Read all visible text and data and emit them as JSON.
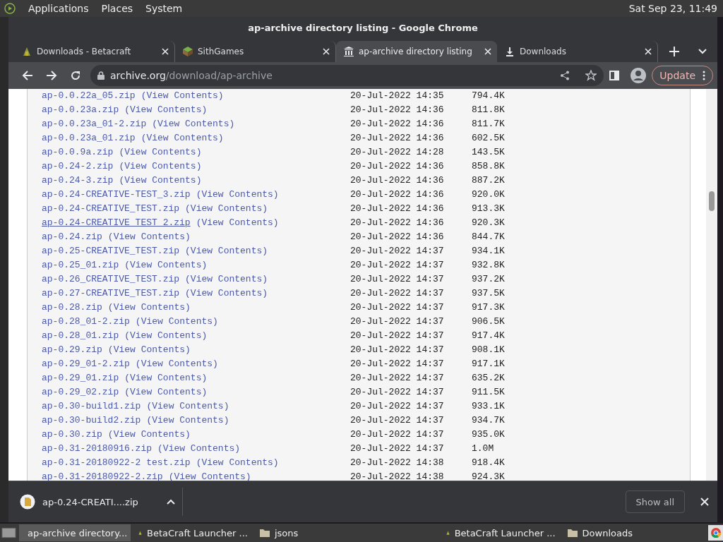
{
  "top_panel": {
    "menus": [
      "Applications",
      "Places",
      "System"
    ],
    "clock": "Sat Sep 23, 11:49"
  },
  "window": {
    "title": "ap-archive directory listing - Google Chrome"
  },
  "tabs": [
    {
      "label": "Downloads - Betacraft",
      "kind": "logo",
      "selected": false
    },
    {
      "label": "SithGames",
      "kind": "block",
      "selected": false
    },
    {
      "label": "ap-archive directory listing",
      "kind": "archive",
      "selected": true
    },
    {
      "label": "Downloads",
      "kind": "download",
      "selected": false
    }
  ],
  "toolbar": {
    "url_host": "archive.org",
    "url_path": "/download/ap-archive",
    "update_label": "Update"
  },
  "listing": {
    "rows": [
      {
        "name": "ap-0.0.22a_05.zip",
        "link": "(View Contents)",
        "date": "20-Jul-2022 14:35",
        "size": "794.4K",
        "hovered": false
      },
      {
        "name": "ap-0.0.23a.zip",
        "link": "(View Contents)",
        "date": "20-Jul-2022 14:36",
        "size": "811.8K",
        "hovered": false
      },
      {
        "name": "ap-0.0.23a_01-2.zip",
        "link": "(View Contents)",
        "date": "20-Jul-2022 14:36",
        "size": "811.7K",
        "hovered": false
      },
      {
        "name": "ap-0.0.23a_01.zip",
        "link": "(View Contents)",
        "date": "20-Jul-2022 14:36",
        "size": "602.5K",
        "hovered": false
      },
      {
        "name": "ap-0.0.9a.zip",
        "link": "(View Contents)",
        "date": "20-Jul-2022 14:28",
        "size": "143.5K",
        "hovered": false
      },
      {
        "name": "ap-0.24-2.zip",
        "link": "(View Contents)",
        "date": "20-Jul-2022 14:36",
        "size": "858.8K",
        "hovered": false
      },
      {
        "name": "ap-0.24-3.zip",
        "link": "(View Contents)",
        "date": "20-Jul-2022 14:36",
        "size": "887.2K",
        "hovered": false
      },
      {
        "name": "ap-0.24-CREATIVE-TEST_3.zip",
        "link": "(View Contents)",
        "date": "20-Jul-2022 14:36",
        "size": "920.0K",
        "hovered": false
      },
      {
        "name": "ap-0.24-CREATIVE_TEST.zip",
        "link": "(View Contents)",
        "date": "20-Jul-2022 14:36",
        "size": "913.3K",
        "hovered": false
      },
      {
        "name": "ap-0.24-CREATIVE_TEST_2.zip",
        "link": "(View Contents)",
        "date": "20-Jul-2022 14:36",
        "size": "920.3K",
        "hovered": true
      },
      {
        "name": "ap-0.24.zip",
        "link": "(View Contents)",
        "date": "20-Jul-2022 14:36",
        "size": "844.7K",
        "hovered": false
      },
      {
        "name": "ap-0.25-CREATIVE_TEST.zip",
        "link": "(View Contents)",
        "date": "20-Jul-2022 14:37",
        "size": "934.1K",
        "hovered": false
      },
      {
        "name": "ap-0.25_01.zip",
        "link": "(View Contents)",
        "date": "20-Jul-2022 14:37",
        "size": "932.8K",
        "hovered": false
      },
      {
        "name": "ap-0.26_CREATIVE_TEST.zip",
        "link": "(View Contents)",
        "date": "20-Jul-2022 14:37",
        "size": "937.2K",
        "hovered": false
      },
      {
        "name": "ap-0.27-CREATIVE_TEST.zip",
        "link": "(View Contents)",
        "date": "20-Jul-2022 14:37",
        "size": "937.5K",
        "hovered": false
      },
      {
        "name": "ap-0.28.zip",
        "link": "(View Contents)",
        "date": "20-Jul-2022 14:37",
        "size": "917.3K",
        "hovered": false
      },
      {
        "name": "ap-0.28_01-2.zip",
        "link": "(View Contents)",
        "date": "20-Jul-2022 14:37",
        "size": "906.5K",
        "hovered": false
      },
      {
        "name": "ap-0.28_01.zip",
        "link": "(View Contents)",
        "date": "20-Jul-2022 14:37",
        "size": "917.4K",
        "hovered": false
      },
      {
        "name": "ap-0.29.zip",
        "link": "(View Contents)",
        "date": "20-Jul-2022 14:37",
        "size": "908.1K",
        "hovered": false
      },
      {
        "name": "ap-0.29_01-2.zip",
        "link": "(View Contents)",
        "date": "20-Jul-2022 14:37",
        "size": "917.1K",
        "hovered": false
      },
      {
        "name": "ap-0.29_01.zip",
        "link": "(View Contents)",
        "date": "20-Jul-2022 14:37",
        "size": "635.2K",
        "hovered": false
      },
      {
        "name": "ap-0.29_02.zip",
        "link": "(View Contents)",
        "date": "20-Jul-2022 14:37",
        "size": "911.5K",
        "hovered": false
      },
      {
        "name": "ap-0.30-build1.zip",
        "link": "(View Contents)",
        "date": "20-Jul-2022 14:37",
        "size": "933.1K",
        "hovered": false
      },
      {
        "name": "ap-0.30-build2.zip",
        "link": "(View Contents)",
        "date": "20-Jul-2022 14:37",
        "size": "934.7K",
        "hovered": false
      },
      {
        "name": "ap-0.30.zip",
        "link": "(View Contents)",
        "date": "20-Jul-2022 14:37",
        "size": "935.0K",
        "hovered": false
      },
      {
        "name": "ap-0.31-20180916.zip",
        "link": "(View Contents)",
        "date": "20-Jul-2022 14:37",
        "size": "1.0M",
        "hovered": false
      },
      {
        "name": "ap-0.31-20180922-2 test.zip",
        "link": "(View Contents)",
        "date": "20-Jul-2022 14:38",
        "size": "918.4K",
        "hovered": false
      },
      {
        "name": "ap-0.31-20180922-2.zip",
        "link": "(View Contents)",
        "date": "20-Jul-2022 14:38",
        "size": "924.3K",
        "hovered": false
      }
    ]
  },
  "download_bar": {
    "file": "ap-0.24-CREATI....zip",
    "show_all": "Show all"
  },
  "taskbar": {
    "items": [
      {
        "label": "ap-archive directory...",
        "kind": "chrome",
        "selected": true
      },
      {
        "label": "BetaCraft Launcher ...",
        "kind": "logo",
        "selected": false
      },
      {
        "label": "jsons",
        "kind": "folder",
        "selected": false
      },
      {
        "label": "BetaCraft Launcher ...",
        "kind": "logo",
        "selected": false
      },
      {
        "label": "Downloads",
        "kind": "folder",
        "selected": false
      }
    ]
  }
}
